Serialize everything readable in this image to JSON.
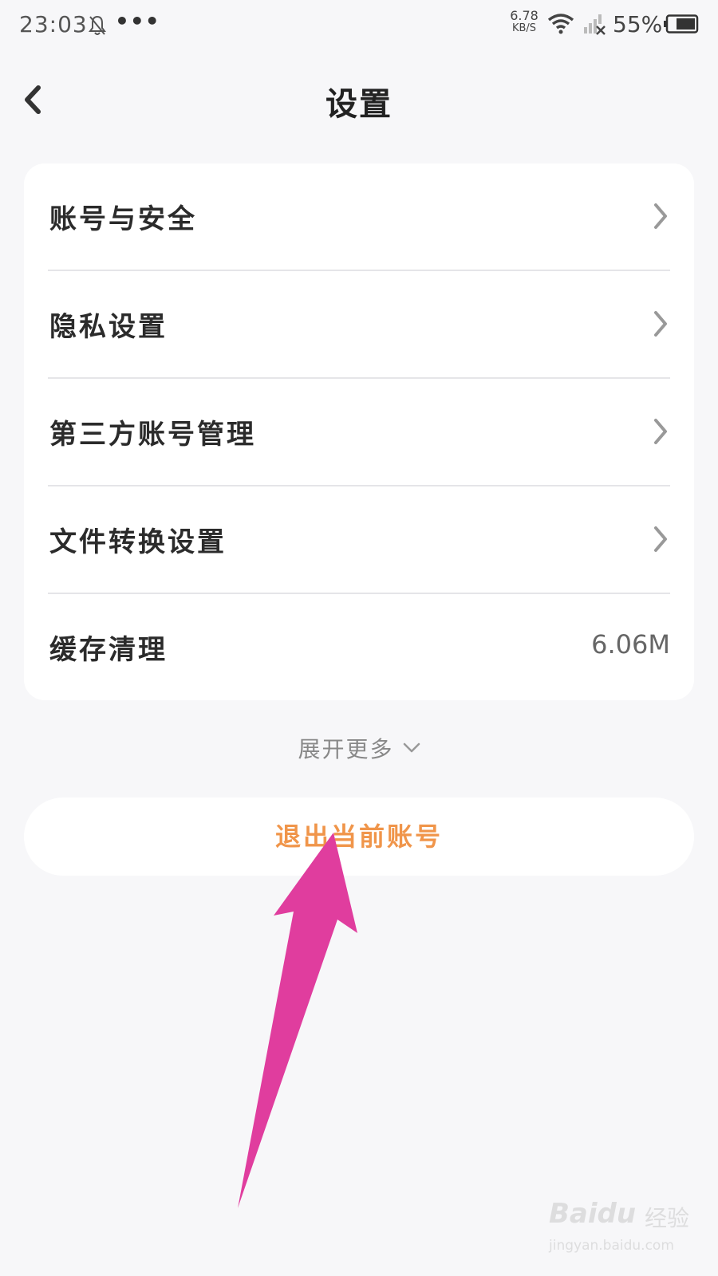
{
  "status_bar": {
    "time": "23:03",
    "dots": "•••",
    "net_speed_value": "6.78",
    "net_speed_unit": "KB/S",
    "battery_percent": "55%"
  },
  "header": {
    "title": "设置",
    "back_icon": "chevron-left-icon"
  },
  "settings": {
    "items": [
      {
        "label": "账号与安全",
        "type": "nav"
      },
      {
        "label": "隐私设置",
        "type": "nav"
      },
      {
        "label": "第三方账号管理",
        "type": "nav"
      },
      {
        "label": "文件转换设置",
        "type": "nav"
      },
      {
        "label": "缓存清理",
        "type": "value",
        "value": "6.06M"
      }
    ]
  },
  "expand_more": {
    "label": "展开更多"
  },
  "logout": {
    "label": "退出当前账号"
  },
  "colors": {
    "accent": "#f0954a",
    "annotation_arrow": "#e03d9e",
    "background": "#f7f7f9"
  },
  "watermark": {
    "brand": "Baidu",
    "brand_suffix": "经验",
    "url": "jingyan.baidu.com"
  }
}
